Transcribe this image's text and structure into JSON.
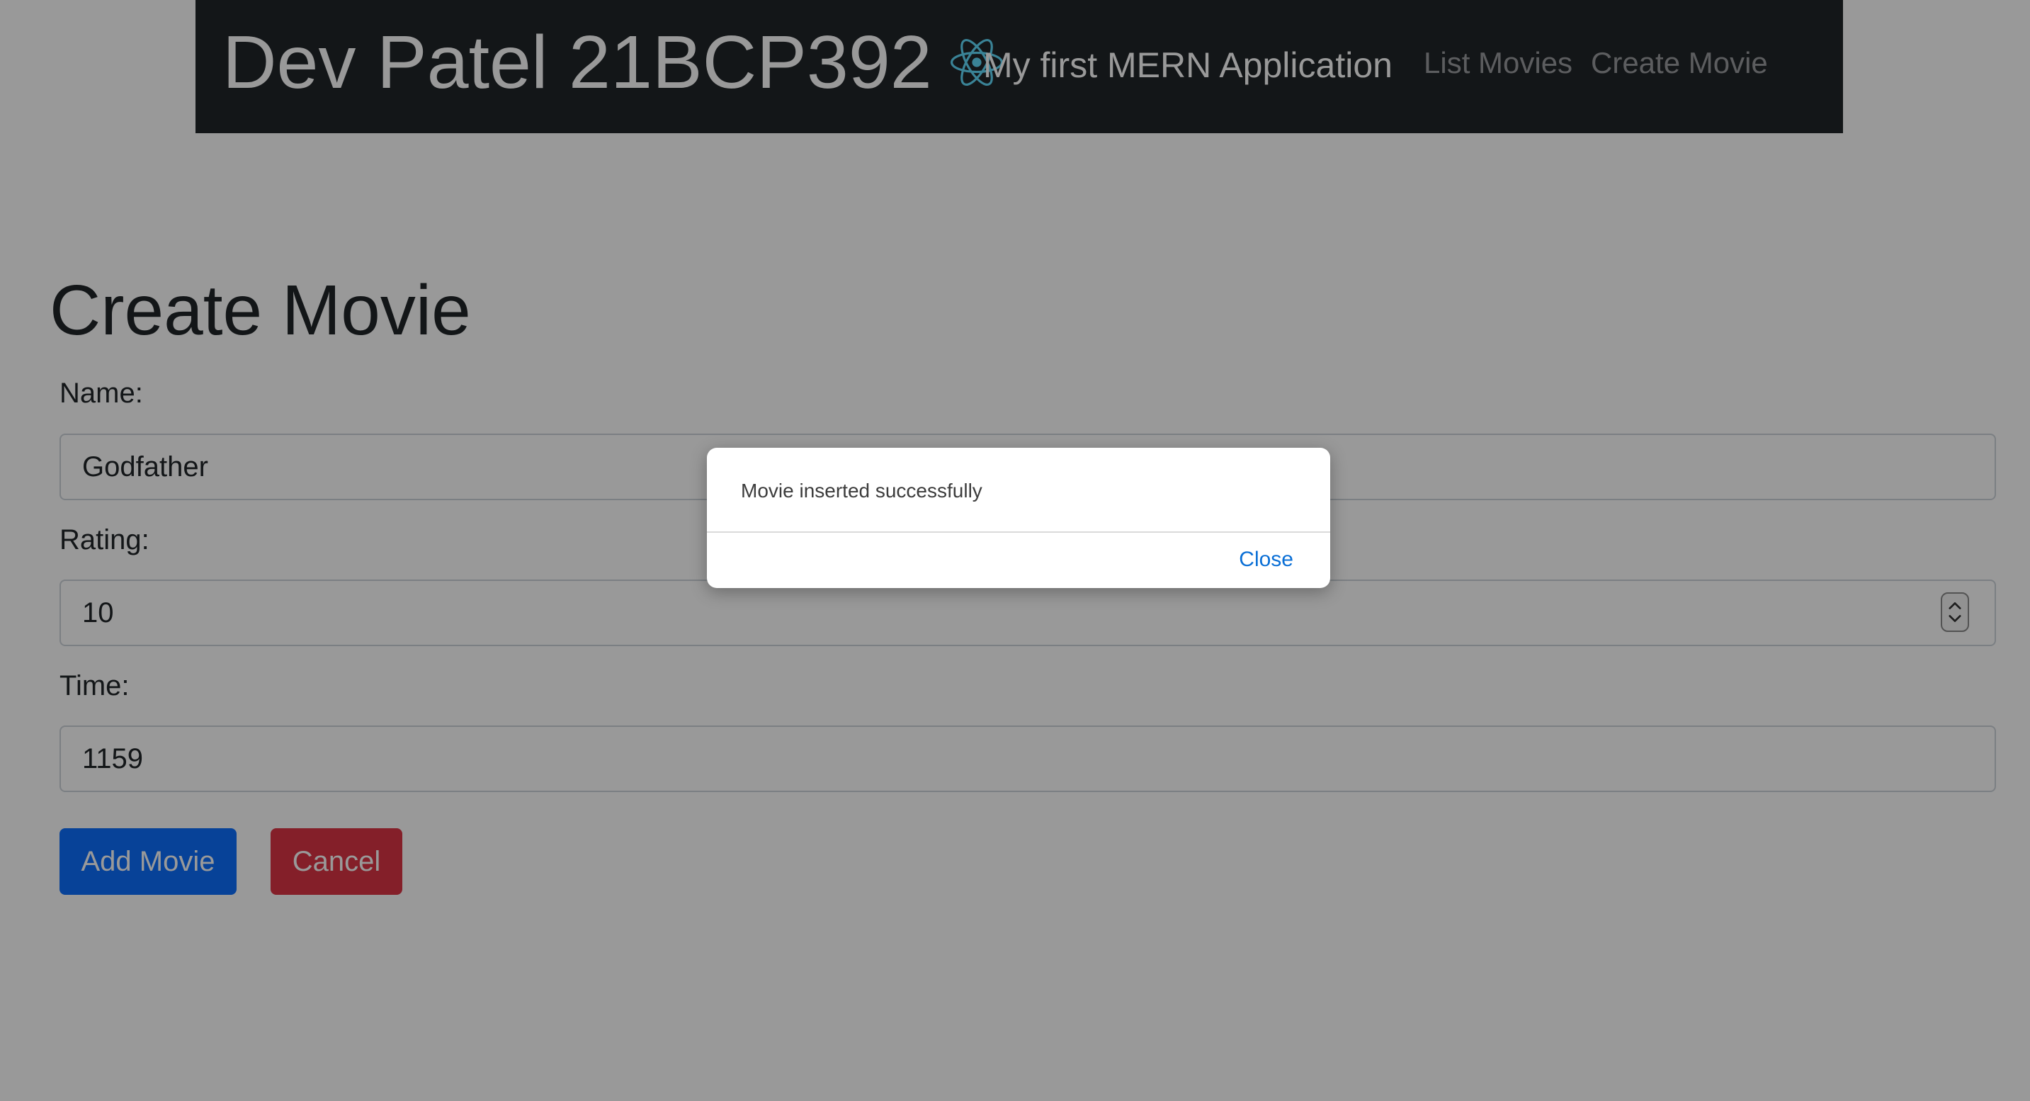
{
  "navbar": {
    "brand": "Dev Patel 21BCP392",
    "brand_icon": "react-logo-icon",
    "app_title": "My first MERN Application",
    "links": [
      {
        "label": "List Movies"
      },
      {
        "label": "Create Movie"
      }
    ],
    "background_color": "#212529",
    "icon_color": "#61dafb"
  },
  "page": {
    "title": "Create Movie"
  },
  "form": {
    "name": {
      "label": "Name:",
      "value": "Godfather"
    },
    "rating": {
      "label": "Rating:",
      "value": "10"
    },
    "time": {
      "label": "Time:",
      "value": "1159"
    },
    "add_button": "Add Movie",
    "cancel_button": "Cancel",
    "add_color": "#0d6efd",
    "cancel_color": "#dc3545"
  },
  "dialog": {
    "message": "Movie inserted successfully",
    "close_label": "Close",
    "close_color": "#0a6fd6"
  }
}
